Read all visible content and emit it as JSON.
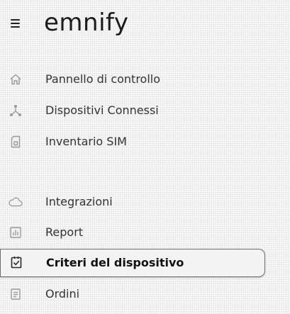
{
  "brand": {
    "name": "emnify"
  },
  "nav": {
    "items": [
      {
        "label": "Pannello di controllo",
        "icon": "home-icon"
      },
      {
        "label": "Dispositivi Connessi",
        "icon": "network-icon"
      },
      {
        "label": "Inventario SIM",
        "icon": "sim-card-icon"
      },
      {
        "label": "Integrazioni",
        "icon": "cloud-icon"
      },
      {
        "label": "Report",
        "icon": "bar-chart-icon"
      },
      {
        "label": "Criteri del dispositivo",
        "icon": "clipboard-check-icon",
        "active": true
      },
      {
        "label": "Ordini",
        "icon": "document-icon"
      }
    ]
  },
  "colors": {
    "icon_muted": "#9a9a9a",
    "icon_active": "#2a2a2a",
    "active_border": "#6d6d6d"
  }
}
